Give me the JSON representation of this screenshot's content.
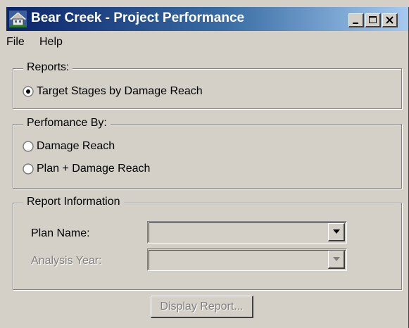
{
  "window": {
    "title": "Bear Creek - Project Performance"
  },
  "menu": {
    "file": "File",
    "help": "Help"
  },
  "reports": {
    "legend": "Reports:",
    "option": "Target Stages by Damage Reach",
    "selected": true
  },
  "performance": {
    "legend": "Perfomance By:",
    "options": [
      "Damage Reach",
      "Plan + Damage Reach"
    ]
  },
  "report_info": {
    "legend": "Report Information",
    "plan_name_label": "Plan Name:",
    "plan_name_value": "",
    "analysis_year_label": "Analysis Year:",
    "analysis_year_value": ""
  },
  "buttons": {
    "display_report": "Display Report..."
  },
  "icons": {
    "app": "house-icon",
    "minimize": "minimize-icon",
    "maximize": "maximize-icon",
    "close": "close-icon",
    "dropdown": "chevron-down-icon"
  }
}
